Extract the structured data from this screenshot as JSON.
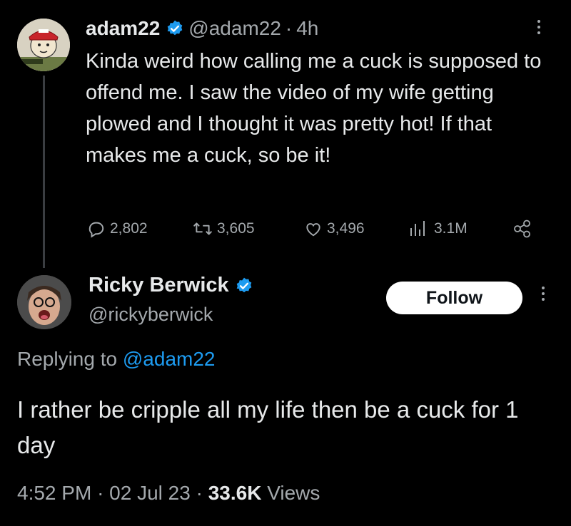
{
  "parent_tweet": {
    "name": "adam22",
    "handle": "@adam22",
    "separator": "·",
    "time": "4h",
    "text": "Kinda weird how calling me a cuck is supposed to offend me. I saw the video of my wife getting plowed and I thought it was pretty hot! If that makes me a cuck, so be it!",
    "actions": {
      "replies": "2,802",
      "retweets": "3,605",
      "likes": "3,496",
      "views": "3.1M"
    },
    "icons": [
      "verified-badge-icon",
      "more-icon",
      "reply-icon",
      "retweet-icon",
      "like-icon",
      "views-icon",
      "share-icon"
    ]
  },
  "main_tweet": {
    "name": "Ricky Berwick",
    "handle": "@rickyberwick",
    "follow_label": "Follow",
    "replying_prefix": "Replying to",
    "replying_mention": "@adam22",
    "text": "I rather be cripple all my life then be a cuck for 1 day",
    "time": "4:52 PM",
    "date": "02 Jul 23",
    "views_count": "33.6K",
    "views_label": "Views",
    "separator": "·"
  },
  "colors": {
    "background": "#000000",
    "text_primary": "#e7e9ea",
    "text_secondary": "#a4a9ad",
    "verified_blue": "#1d9bf0",
    "thread_line": "#3a3d41",
    "follow_bg": "#ffffff"
  }
}
